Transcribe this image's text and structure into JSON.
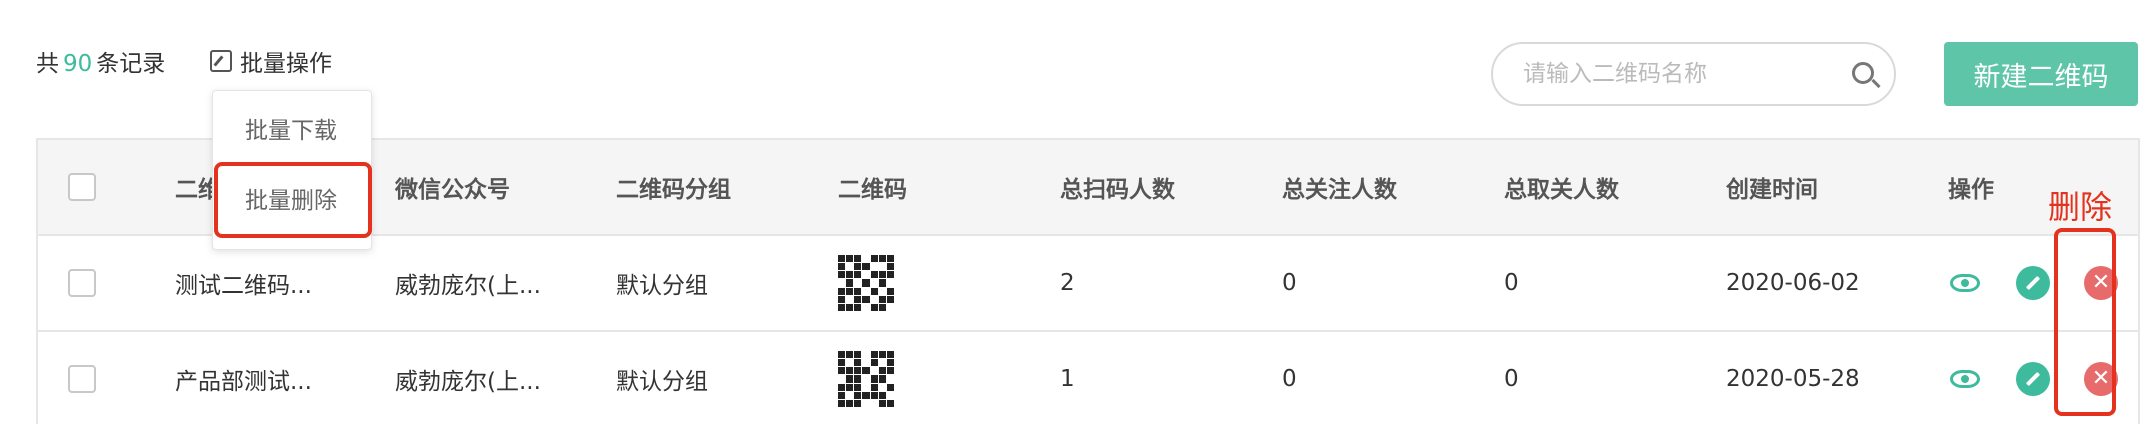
{
  "header": {
    "count_prefix": "共",
    "count_value": "90",
    "count_suffix": "条记录",
    "batch_label": "批量操作",
    "search_placeholder": "请输入二维码名称",
    "new_button": "新建二维码"
  },
  "dropdown": {
    "items": [
      "批量下载",
      "批量删除"
    ]
  },
  "table": {
    "columns": [
      "二维",
      "微信公众号",
      "二维码分组",
      "二维码",
      "总扫码人数",
      "总关注人数",
      "总取关人数",
      "创建时间",
      "操作"
    ],
    "rows": [
      {
        "name": "测试二维码...",
        "account": "威勃庞尔(上...",
        "group": "默认分组",
        "scans": "2",
        "follows": "0",
        "unfollows": "0",
        "created": "2020-06-02"
      },
      {
        "name": "产品部测试...",
        "account": "威勃庞尔(上...",
        "group": "默认分组",
        "scans": "1",
        "follows": "0",
        "unfollows": "0",
        "created": "2020-05-28"
      }
    ]
  },
  "annotation": {
    "delete_label": "删除",
    "color": "#e4321e"
  },
  "colors": {
    "accent": "#3dbb9c",
    "button": "#5ec5a9",
    "danger": "#e86b6b"
  },
  "icons": [
    "checkbox-icon",
    "search-icon",
    "edit-square-icon",
    "qr-code-icon",
    "eye-icon",
    "pencil-icon",
    "close-circle-icon"
  ]
}
